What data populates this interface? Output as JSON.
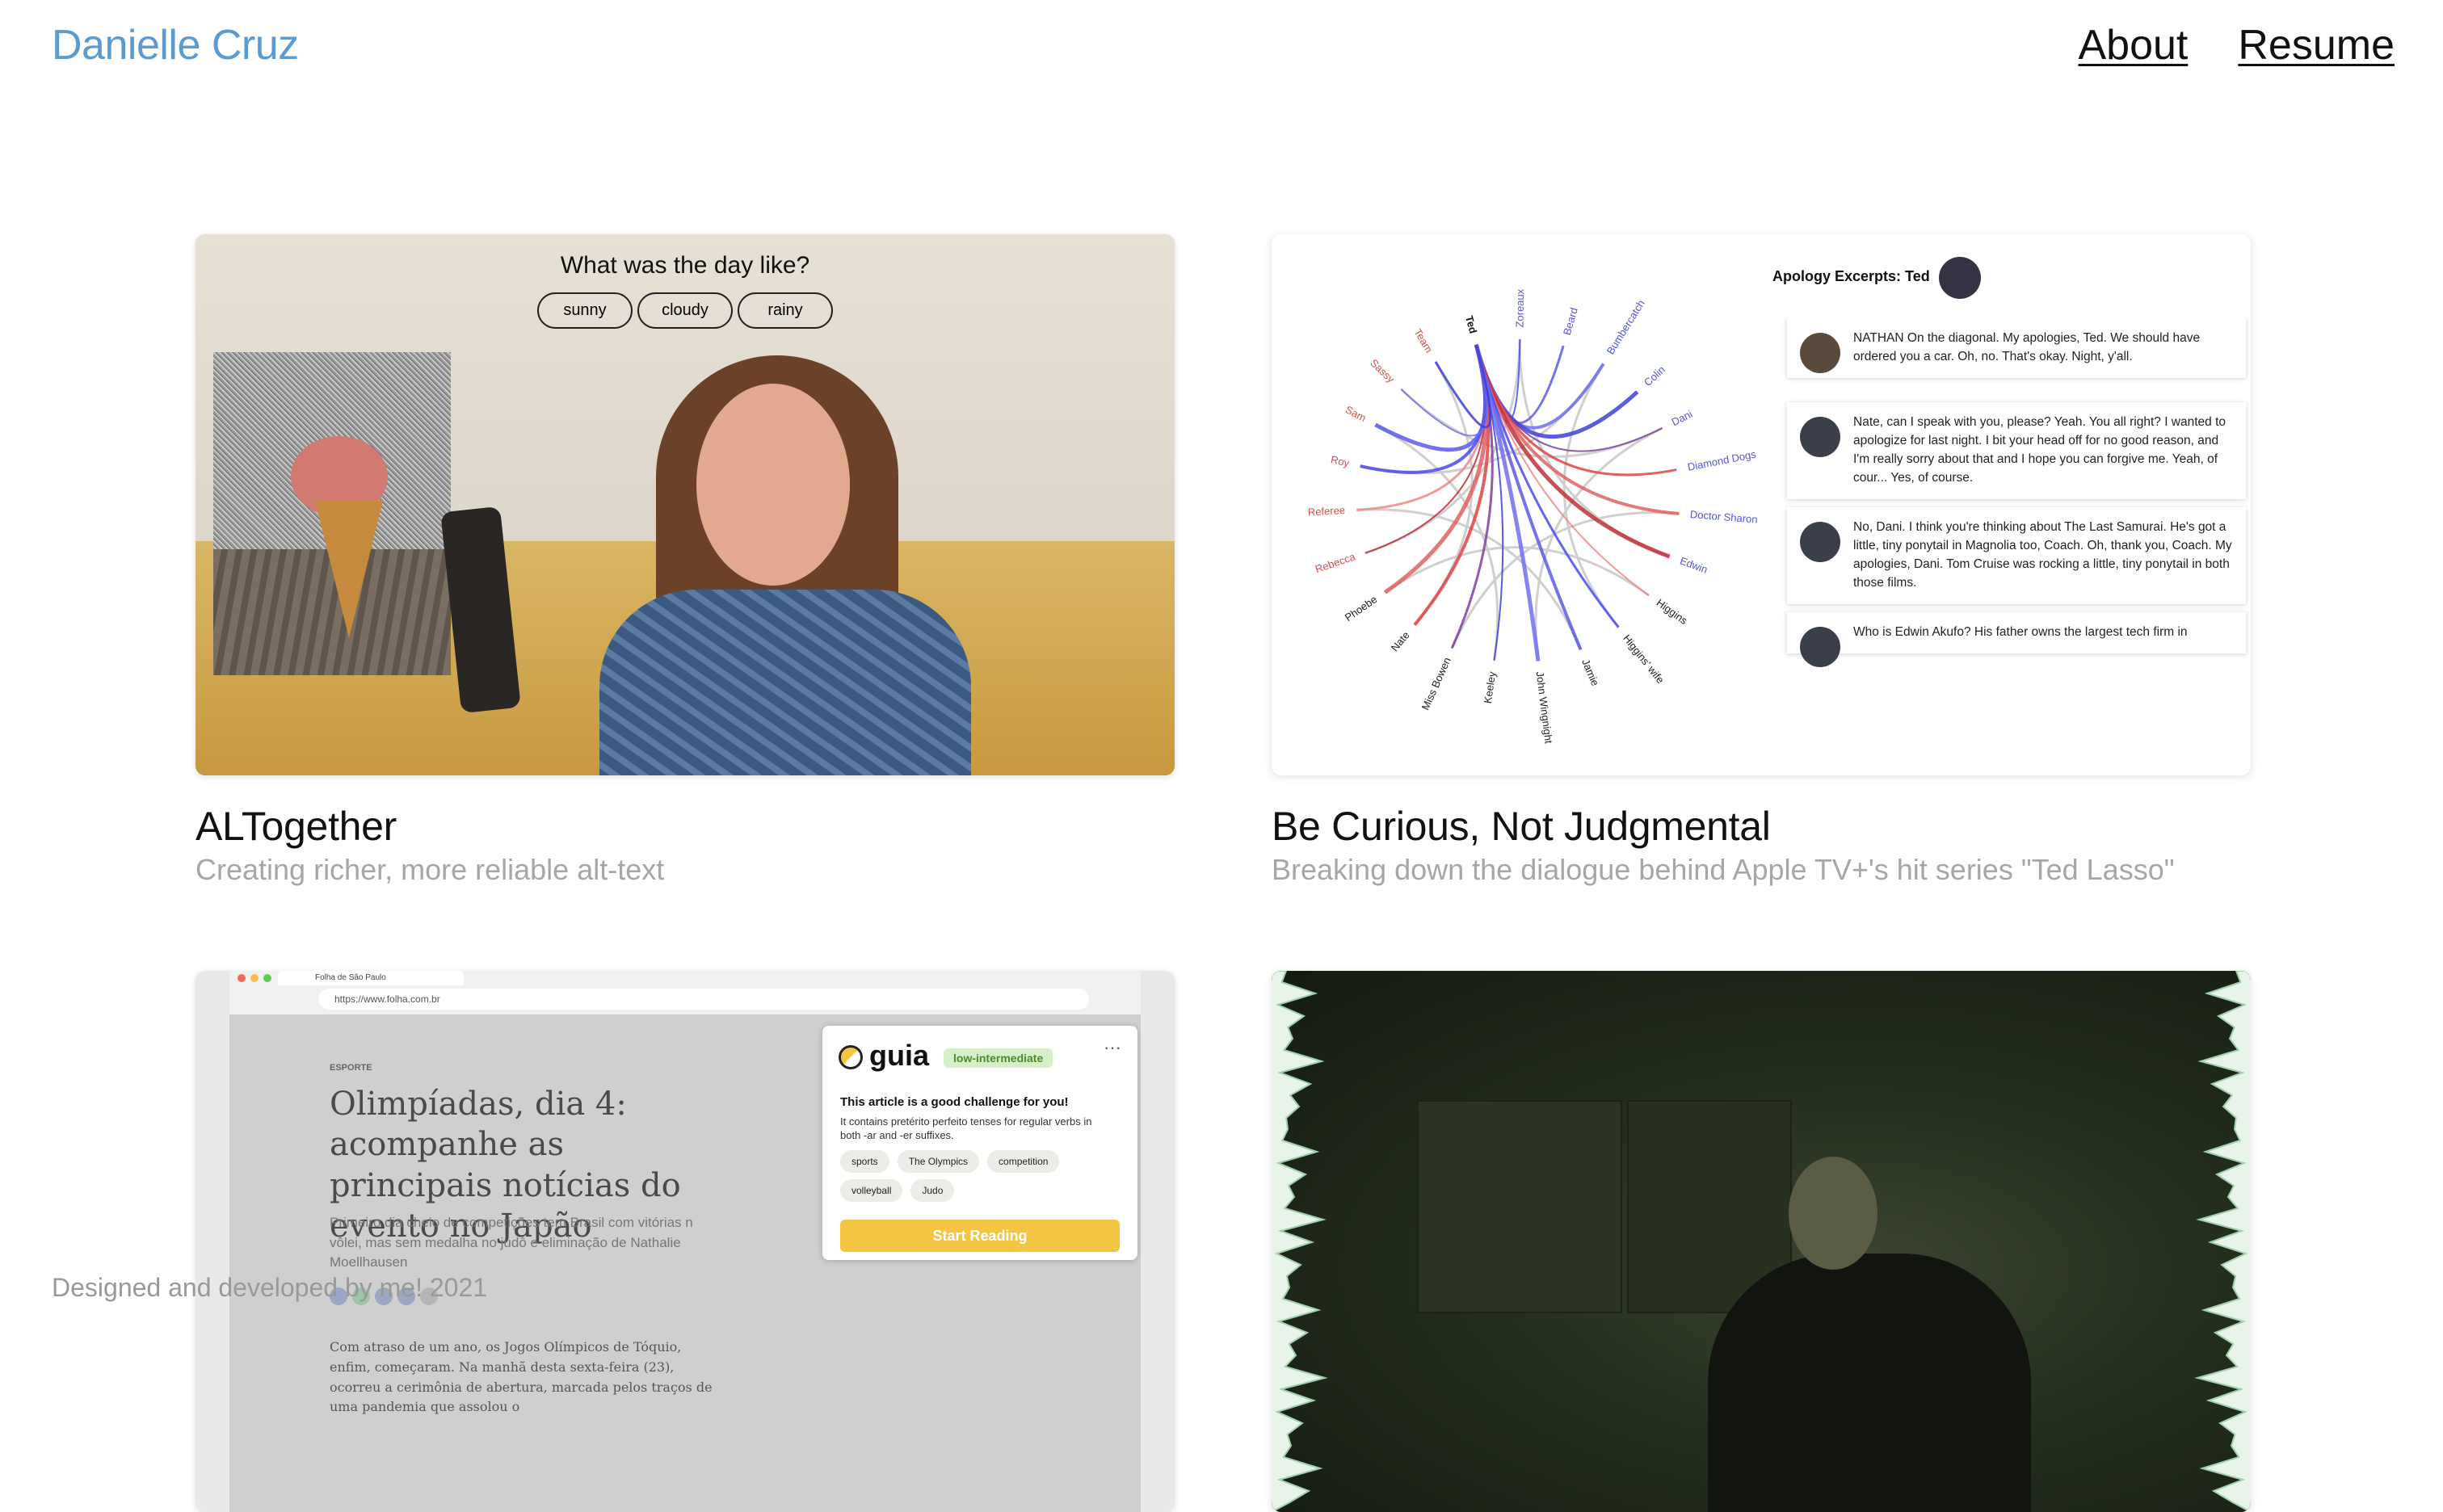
{
  "header": {
    "name": "Danielle Cruz",
    "nav": [
      {
        "label": "About"
      },
      {
        "label": "Resume"
      }
    ]
  },
  "projects": [
    {
      "title": "ALTogether",
      "subtitle": "Creating richer, more reliable alt-text",
      "thumbnail": {
        "question": "What was the day like?",
        "options": [
          "sunny",
          "cloudy",
          "rainy"
        ]
      }
    },
    {
      "title": "Be Curious, Not Judgmental",
      "subtitle": "Breaking down the dialogue behind Apple TV+'s hit series \"Ted Lasso\"",
      "thumbnail": {
        "panel_title": "Apology Excerpts: Ted",
        "center_label": "Ted",
        "names": [
          "Zoreaux",
          "Beard",
          "Bumbercatch",
          "Colin",
          "Dani",
          "Diamond Dogs",
          "Doctor Sharon",
          "Edwin",
          "Higgins",
          "Higgins' wife",
          "Jamie",
          "John Wingnight",
          "Keeley",
          "Miss Bowen",
          "Nate",
          "Phoebe",
          "Rebecca",
          "Referee",
          "Roy",
          "Sam",
          "Sassy",
          "Team"
        ],
        "excerpts": [
          "NATHAN On the diagonal. My apologies, Ted. We should have ordered you a car. Oh, no. That's okay. Night, y'all.",
          "Nate, can I speak with you, please? Yeah. You all right? I wanted to apologize for last night. I bit your head off for no good reason, and I'm really sorry about that and I hope you can forgive me. Yeah, of cour... Yes, of course.",
          "No, Dani. I think you're thinking about The Last Samurai. He's got a little, tiny ponytail in Magnolia too, Coach. Oh, thank you, Coach. My apologies, Dani. Tom Cruise was rocking a little, tiny ponytail in both those films.",
          "Who is Edwin Akufo? His father owns the largest tech firm in"
        ]
      }
    },
    {
      "title": "",
      "subtitle": "",
      "thumbnail": {
        "tab": "Folha de São Paulo",
        "url": "https://www.folha.com.br",
        "section": "ESPORTE",
        "headline": "Olimpíadas, dia 4: acompanhe as principais notícias do evento no Japão",
        "lede": "Primeiro dia cheio de competições tem Brasil com vitórias n vôlei, mas sem medalha no judô e eliminação de Nathalie Moellhausen",
        "body": "Com atraso de um ano, os Jogos Olímpicos de Tóquio, enfim, começaram. Na manhã desta sexta-feira (23), ocorreu a cerimônia de abertura, marcada pelos traços de uma pandemia que assolou o",
        "panel": {
          "brand": "guia",
          "level": "low-intermediate",
          "challenge": "This article is a good challenge for you!",
          "description": "It contains pretérito perfeito tenses for regular verbs in both -ar and -er suffixes.",
          "tags": [
            "sports",
            "The Olympics",
            "competition",
            "volleyball",
            "Judo"
          ],
          "cta": "Start Reading",
          "more": "···"
        }
      }
    },
    {
      "title": "",
      "subtitle": "",
      "thumbnail": {}
    }
  ],
  "footer": {
    "text": "Designed and developed by me! 2021"
  },
  "colors": {
    "name_link": "#5b9bd0",
    "subtitle": "#a6a6a6",
    "guia_cta": "#f4c542",
    "level_badge": "#d6efc9"
  }
}
